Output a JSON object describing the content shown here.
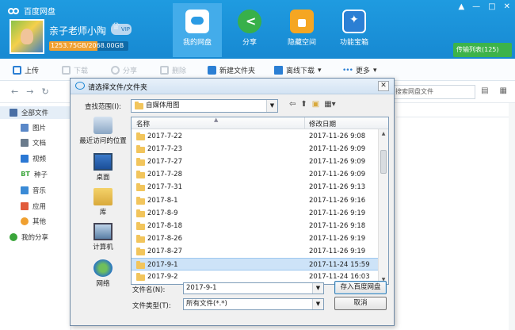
{
  "app": {
    "title": "百度网盘",
    "user_name": "亲子老师小陶",
    "vip_label": "VIP",
    "storage_text": "1253.75GB/2068.00GB",
    "storage_fraction": 0.606,
    "window_controls": [
      "▲",
      "—",
      "□",
      "✕"
    ],
    "transfer_label": "传输列表(125)"
  },
  "nav_tabs": [
    {
      "label": "我的网盘",
      "icon": "cloud-icon",
      "active": true
    },
    {
      "label": "分享",
      "icon": "share-icon",
      "active": false
    },
    {
      "label": "隐藏空间",
      "icon": "lock-icon",
      "active": false
    },
    {
      "label": "功能宝箱",
      "icon": "toolbox-icon",
      "active": false
    }
  ],
  "toolbar": {
    "upload": "上传",
    "download": "下载",
    "share": "分享",
    "delete": "删除",
    "new_folder": "新建文件夹",
    "offline_download": "离线下载",
    "more": "更多"
  },
  "search": {
    "placeholder": "搜索网盘文件"
  },
  "sidebar": {
    "items": [
      {
        "label": "全部文件",
        "icon": "hdd-icon",
        "color": "#4a6fa5"
      },
      {
        "label": "图片",
        "icon": "image-icon",
        "color": "#5a88c8"
      },
      {
        "label": "文档",
        "icon": "document-icon",
        "color": "#6a7b8c"
      },
      {
        "label": "视频",
        "icon": "video-icon",
        "color": "#2b78d4"
      },
      {
        "label": "种子",
        "icon": "bt-icon",
        "color": "#3aa53a"
      },
      {
        "label": "音乐",
        "icon": "music-icon",
        "color": "#3a8ad6"
      },
      {
        "label": "应用",
        "icon": "app-icon",
        "color": "#e15b3b"
      },
      {
        "label": "其他",
        "icon": "other-icon",
        "color": "#f0a030"
      },
      {
        "label": "我的分享",
        "icon": "share-icon",
        "color": "#3aa53a"
      }
    ]
  },
  "dialog": {
    "title": "请选择文件/文件夹",
    "look_in_label": "查找范围(I):",
    "look_in_value": "自媒体用图",
    "places": [
      {
        "label": "最近访问的位置",
        "icon": "recent-places-icon"
      },
      {
        "label": "桌面",
        "icon": "desktop-icon"
      },
      {
        "label": "库",
        "icon": "library-icon"
      },
      {
        "label": "计算机",
        "icon": "computer-icon"
      },
      {
        "label": "网络",
        "icon": "network-icon"
      }
    ],
    "columns": {
      "name": "名称",
      "date": "修改日期"
    },
    "files": [
      {
        "name": "2017-7-22",
        "date": "2017-11-26 9:08"
      },
      {
        "name": "2017-7-23",
        "date": "2017-11-26 9:09"
      },
      {
        "name": "2017-7-27",
        "date": "2017-11-26 9:09"
      },
      {
        "name": "2017-7-28",
        "date": "2017-11-26 9:09"
      },
      {
        "name": "2017-7-31",
        "date": "2017-11-26 9:13"
      },
      {
        "name": "2017-8-1",
        "date": "2017-11-26 9:16"
      },
      {
        "name": "2017-8-9",
        "date": "2017-11-26 9:19"
      },
      {
        "name": "2017-8-18",
        "date": "2017-11-26 9:18"
      },
      {
        "name": "2017-8-26",
        "date": "2017-11-26 9:19"
      },
      {
        "name": "2017-8-27",
        "date": "2017-11-26 9:19"
      },
      {
        "name": "2017-9-1",
        "date": "2017-11-24 15:59"
      },
      {
        "name": "2017-9-2",
        "date": "2017-11-24 16:03"
      }
    ],
    "selected_index": 10,
    "filename_label": "文件名(N):",
    "filename_value": "2017-9-1",
    "filetype_label": "文件类型(T):",
    "filetype_value": "所有文件(*.*)",
    "save_button": "存入百度网盘",
    "cancel_button": "取消"
  }
}
